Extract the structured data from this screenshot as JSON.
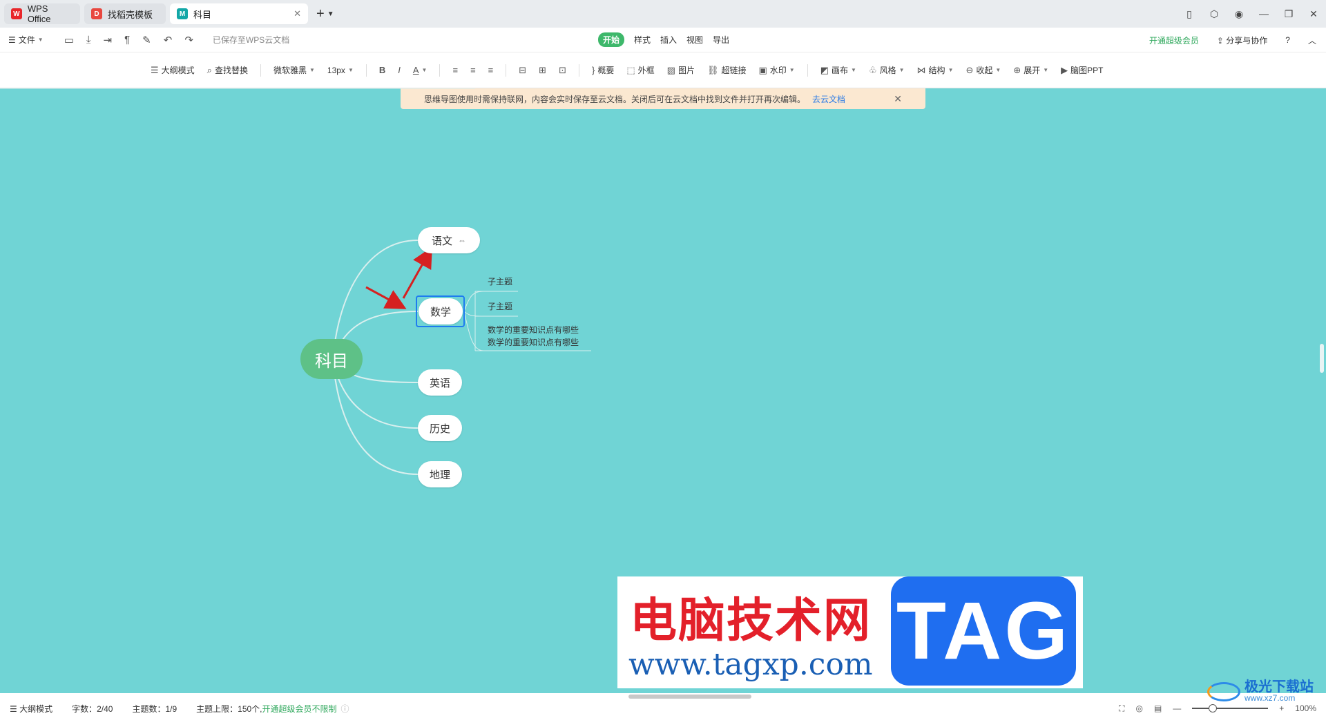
{
  "tabs": [
    {
      "label": "WPS Office",
      "icon": "wps-logo-icon",
      "color": "#e8262a"
    },
    {
      "label": "找稻壳模板",
      "icon": "docer-icon",
      "color": "#e8473f"
    },
    {
      "label": "科目",
      "icon": "mindmap-file-icon",
      "color": "#13a7a7"
    }
  ],
  "menu": {
    "file": "文件",
    "saved_status": "已保存至WPS云文档",
    "tabs": [
      "开始",
      "样式",
      "插入",
      "视图",
      "导出"
    ],
    "vip": "开通超级会员",
    "share": "分享与协作"
  },
  "toolbar": {
    "outline": "大纲模式",
    "find": "查找替换",
    "font": "微软雅黑",
    "size": "13px",
    "summary": "概要",
    "frame": "外框",
    "image": "图片",
    "hyperlink": "超链接",
    "watermark": "水印",
    "canvas": "画布",
    "style": "风格",
    "structure": "结构",
    "collapse": "收起",
    "expand": "展开",
    "ppt": "脑图PPT"
  },
  "notice": {
    "text": "思维导图使用时需保持联网，内容会实时保存至云文档。关闭后可在云文档中找到文件并打开再次编辑。",
    "link": "去云文档"
  },
  "mindmap": {
    "root": "科目",
    "branches": [
      "语文",
      "数学",
      "英语",
      "历史",
      "地理"
    ],
    "math_children": [
      "子主题",
      "子主题",
      "数学的重要知识点有哪些",
      "数学的重要知识点有哪些"
    ]
  },
  "watermark": {
    "cn": "电脑技术网",
    "url": "www.tagxp.com",
    "tag": "TAG",
    "site2": "极光下载站",
    "site2_url": "www.xz7.com"
  },
  "status": {
    "outline": "大纲模式",
    "words": "字数：2/40",
    "topics": "主题数：1/9",
    "limit": "主题上限：150个,",
    "vip_unlimited": "开通超级会员不限制",
    "zoom": "100%"
  },
  "colors": {
    "canvas": "#70d4d5",
    "root": "#5ec187",
    "accent": "#3eb86b",
    "selection": "#1e7cf0",
    "arrow": "#d62020"
  }
}
